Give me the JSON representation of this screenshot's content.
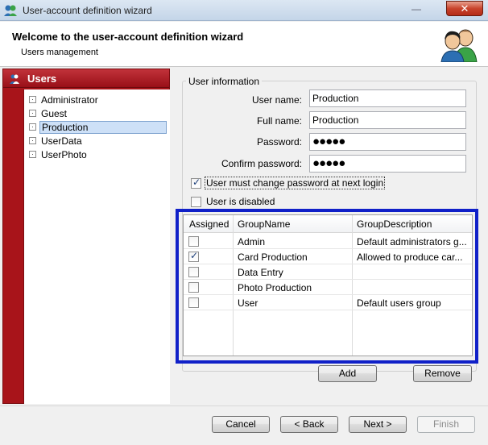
{
  "window": {
    "title": "User-account definition wizard",
    "minimize_glyph": "—",
    "close_glyph": "✕"
  },
  "header": {
    "title": "Welcome to the user-account definition wizard",
    "subtitle": "Users management",
    "icon": "users-icon"
  },
  "sidebar": {
    "title": "Users",
    "items": [
      {
        "label": "Administrator",
        "selected": false
      },
      {
        "label": "Guest",
        "selected": false
      },
      {
        "label": "Production",
        "selected": true
      },
      {
        "label": "UserData",
        "selected": false
      },
      {
        "label": "UserPhoto",
        "selected": false
      }
    ]
  },
  "user_info": {
    "group_title": "User information",
    "username_label": "User name:",
    "username_value": "Production",
    "fullname_label": "Full name:",
    "fullname_value": "Production",
    "password_label": "Password:",
    "password_value": "●●●●●",
    "confirm_label": "Confirm password:",
    "confirm_value": "●●●●●",
    "must_change_label": "User must change password at next login",
    "must_change_checked": true,
    "disabled_label": "User is disabled",
    "disabled_checked": false
  },
  "groups": {
    "columns": [
      "Assigned",
      "GroupName",
      "GroupDescription"
    ],
    "rows": [
      {
        "assigned": false,
        "name": "Admin",
        "description": "Default administrators g..."
      },
      {
        "assigned": true,
        "name": "Card Production",
        "description": "Allowed to produce car..."
      },
      {
        "assigned": false,
        "name": "Data Entry",
        "description": ""
      },
      {
        "assigned": false,
        "name": "Photo Production",
        "description": ""
      },
      {
        "assigned": false,
        "name": "User",
        "description": "Default users group"
      }
    ],
    "add_label": "Add",
    "remove_label": "Remove"
  },
  "footer": {
    "cancel_label": "Cancel",
    "back_label": "< Back",
    "next_label": "Next >",
    "finish_label": "Finish"
  },
  "colors": {
    "sidebar_red": "#a8141a",
    "highlight_blue": "#1020c8"
  }
}
